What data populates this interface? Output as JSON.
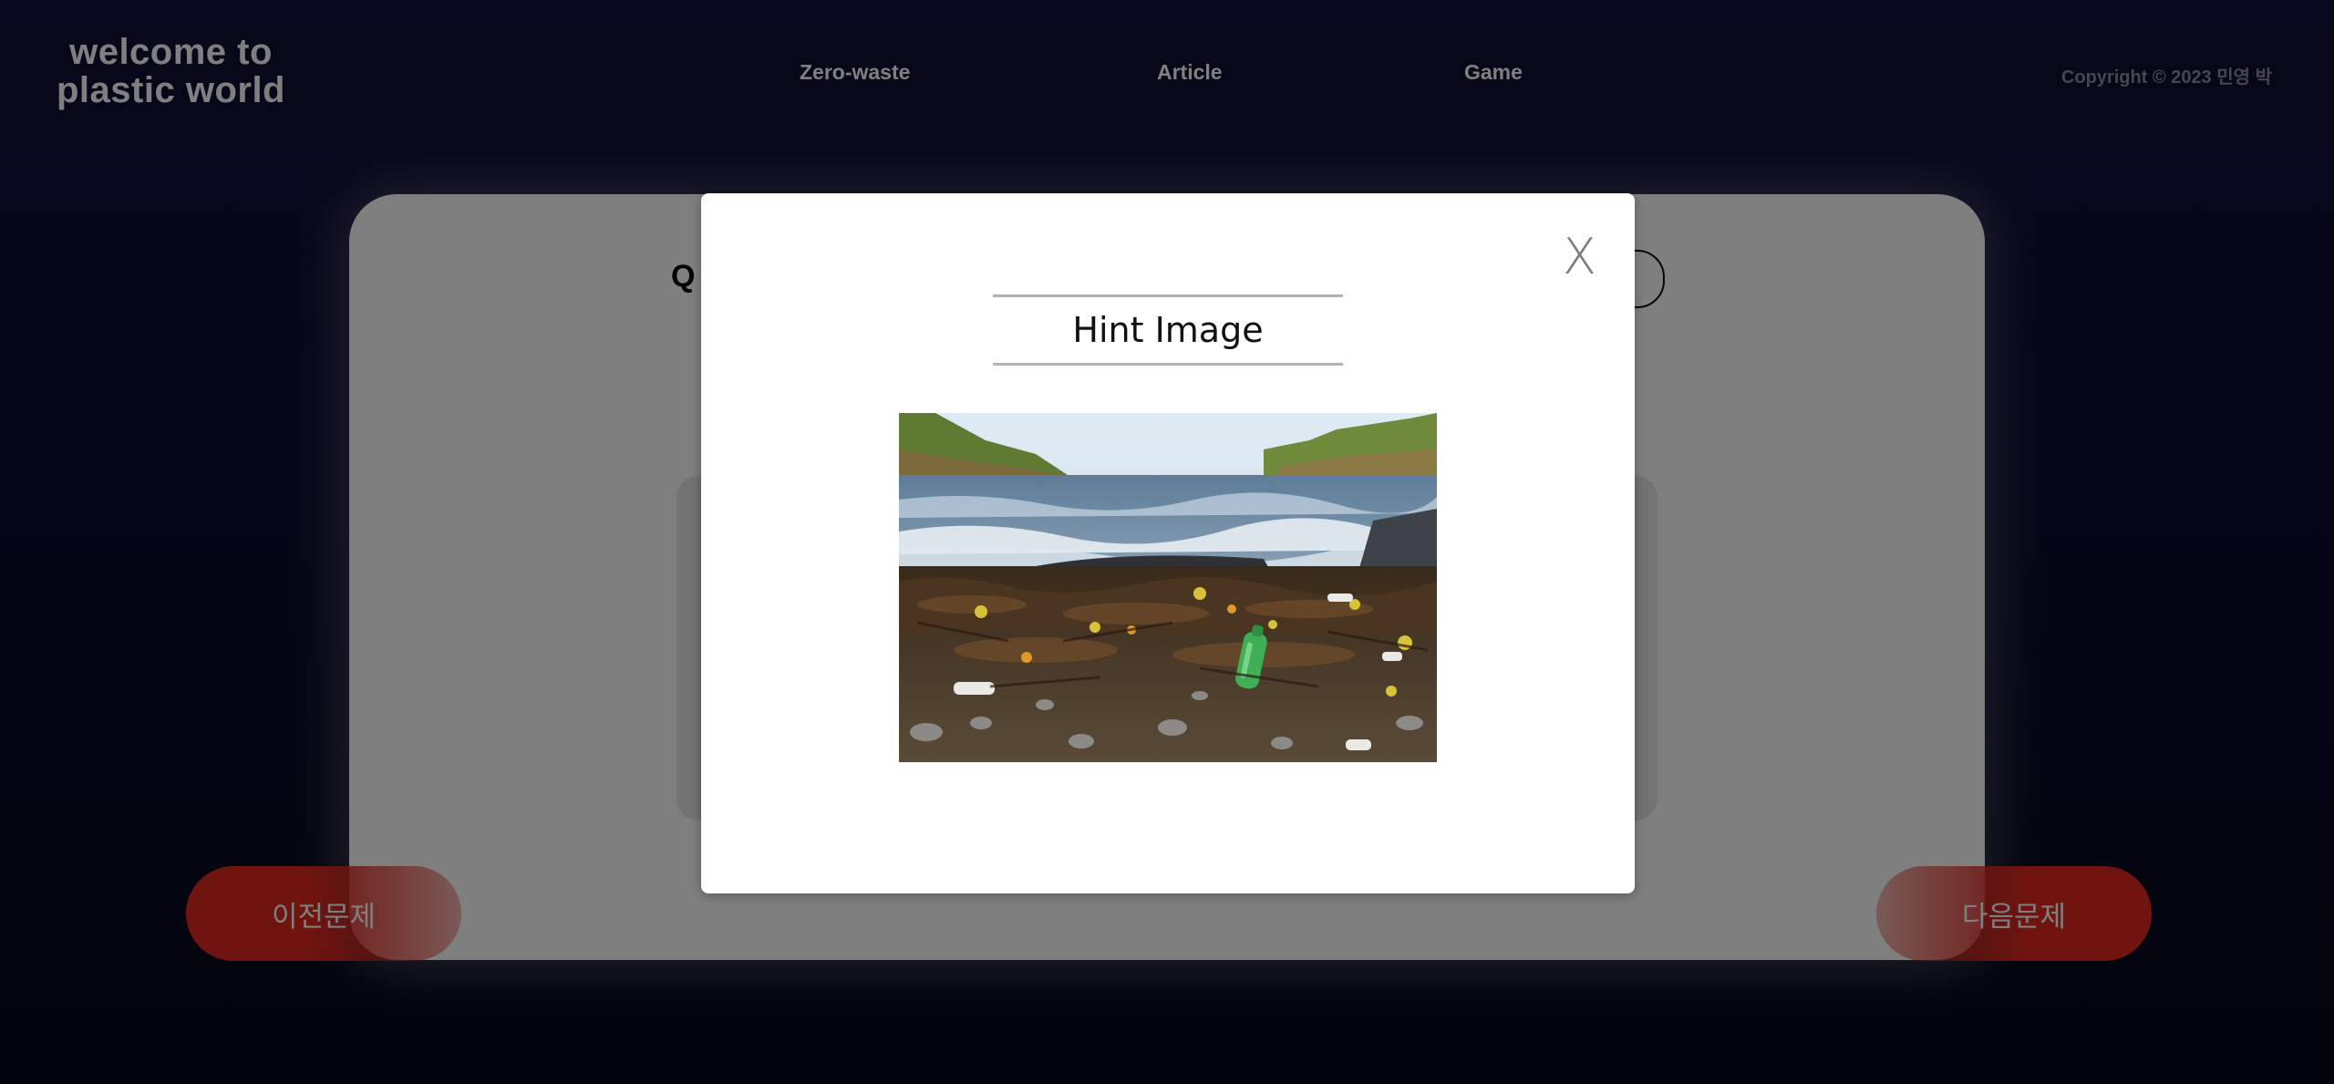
{
  "brand": {
    "line1": "welcome to",
    "line2": "plastic world"
  },
  "nav": {
    "zero_waste": "Zero-waste",
    "article": "Article",
    "game": "Game"
  },
  "copyright": "Copyright © 2023 민영 박",
  "quiz": {
    "question_prefix": "Q",
    "prev_label": "이전문제",
    "next_label": "다음문제"
  },
  "modal": {
    "title": "Hint Image",
    "close_label": "X",
    "image_icon": "beach-plastic-debris-image"
  },
  "colors": {
    "background": "#0c1036",
    "accent_red": "#e0291f",
    "overlay": "rgba(0,0,0,0.5)"
  }
}
